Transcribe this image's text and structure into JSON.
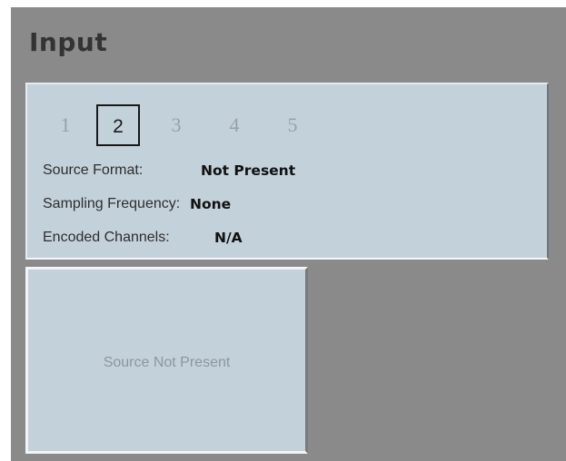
{
  "header": {
    "title": "Input"
  },
  "input_tabs": {
    "items": [
      "1",
      "2",
      "3",
      "4",
      "5"
    ],
    "selected": "2"
  },
  "info": {
    "source_format_label": "Source Format:",
    "source_format_value": "Not Present",
    "sampling_frequency_label": "Sampling Frequency:",
    "sampling_frequency_value": "None",
    "encoded_channels_label": "Encoded Channels:",
    "encoded_channels_value": "N/A"
  },
  "source_preview": {
    "status": "Source Not Present"
  },
  "colors": {
    "background": "#8a8a8a",
    "panel": "#c3d1da",
    "title": "#333333",
    "tab_inactive": "#96a2aa",
    "tab_selected_border": "#181818"
  }
}
